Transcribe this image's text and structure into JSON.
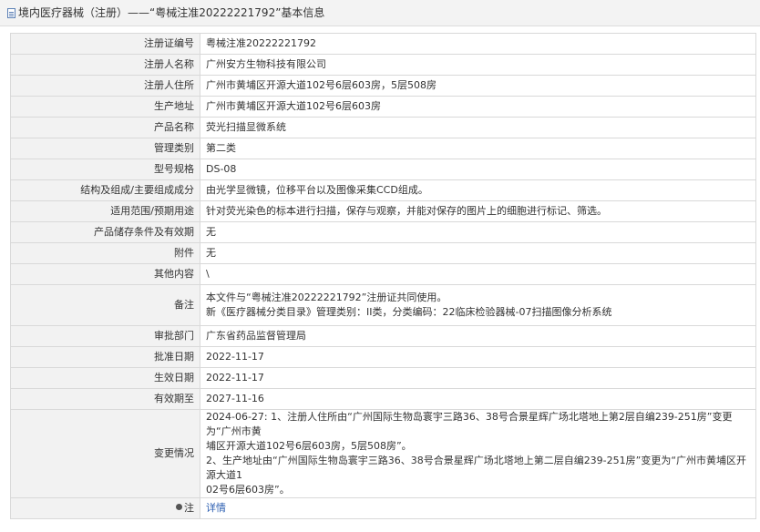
{
  "header": {
    "title": "境内医疗器械（注册）——“粤械注准20222221792”基本信息"
  },
  "rows": [
    {
      "label": "注册证编号",
      "value": "粤械注准20222221792"
    },
    {
      "label": "注册人名称",
      "value": "广州安方生物科技有限公司"
    },
    {
      "label": "注册人住所",
      "value": "广州市黄埔区开源大道102号6层603房，5层508房"
    },
    {
      "label": "生产地址",
      "value": "广州市黄埔区开源大道102号6层603房"
    },
    {
      "label": "产品名称",
      "value": "荧光扫描显微系统"
    },
    {
      "label": "管理类别",
      "value": "第二类"
    },
    {
      "label": "型号规格",
      "value": "DS-08"
    },
    {
      "label": "结构及组成/主要组成成分",
      "value": "由光学显微镜，位移平台以及图像采集CCD组成。"
    },
    {
      "label": "适用范围/预期用途",
      "value": "针对荧光染色的标本进行扫描，保存与观察，并能对保存的图片上的细胞进行标记、筛选。"
    },
    {
      "label": "产品储存条件及有效期",
      "value": "无"
    },
    {
      "label": "附件",
      "value": "无"
    },
    {
      "label": "其他内容",
      "value": "\\"
    },
    {
      "label": "备注",
      "lines": [
        "本文件与“粤械注准20222221792”注册证共同使用。",
        "新《医疗器械分类目录》管理类别：II类，分类编码：22临床检验器械-07扫描图像分析系统"
      ]
    },
    {
      "label": "审批部门",
      "value": "广东省药品监督管理局"
    },
    {
      "label": "批准日期",
      "value": "2022-11-17"
    },
    {
      "label": "生效日期",
      "value": "2022-11-17"
    },
    {
      "label": "有效期至",
      "value": "2027-11-16"
    },
    {
      "label": "变更情况",
      "lines": [
        "2024-06-27: 1、注册人住所由“广州国际生物岛寰宇三路36、38号合景星辉广场北塔地上第2层自编239-251房”变更为“广州市黄",
        "埔区开源大道102号6层603房，5层508房”。",
        "2、生产地址由“广州国际生物岛寰宇三路36、38号合景星辉广场北塔地上第二层自编239-251房”变更为“广州市黄埔区开源大道1",
        "02号6层603房”。"
      ]
    },
    {
      "label": "注",
      "value": "详情"
    }
  ]
}
